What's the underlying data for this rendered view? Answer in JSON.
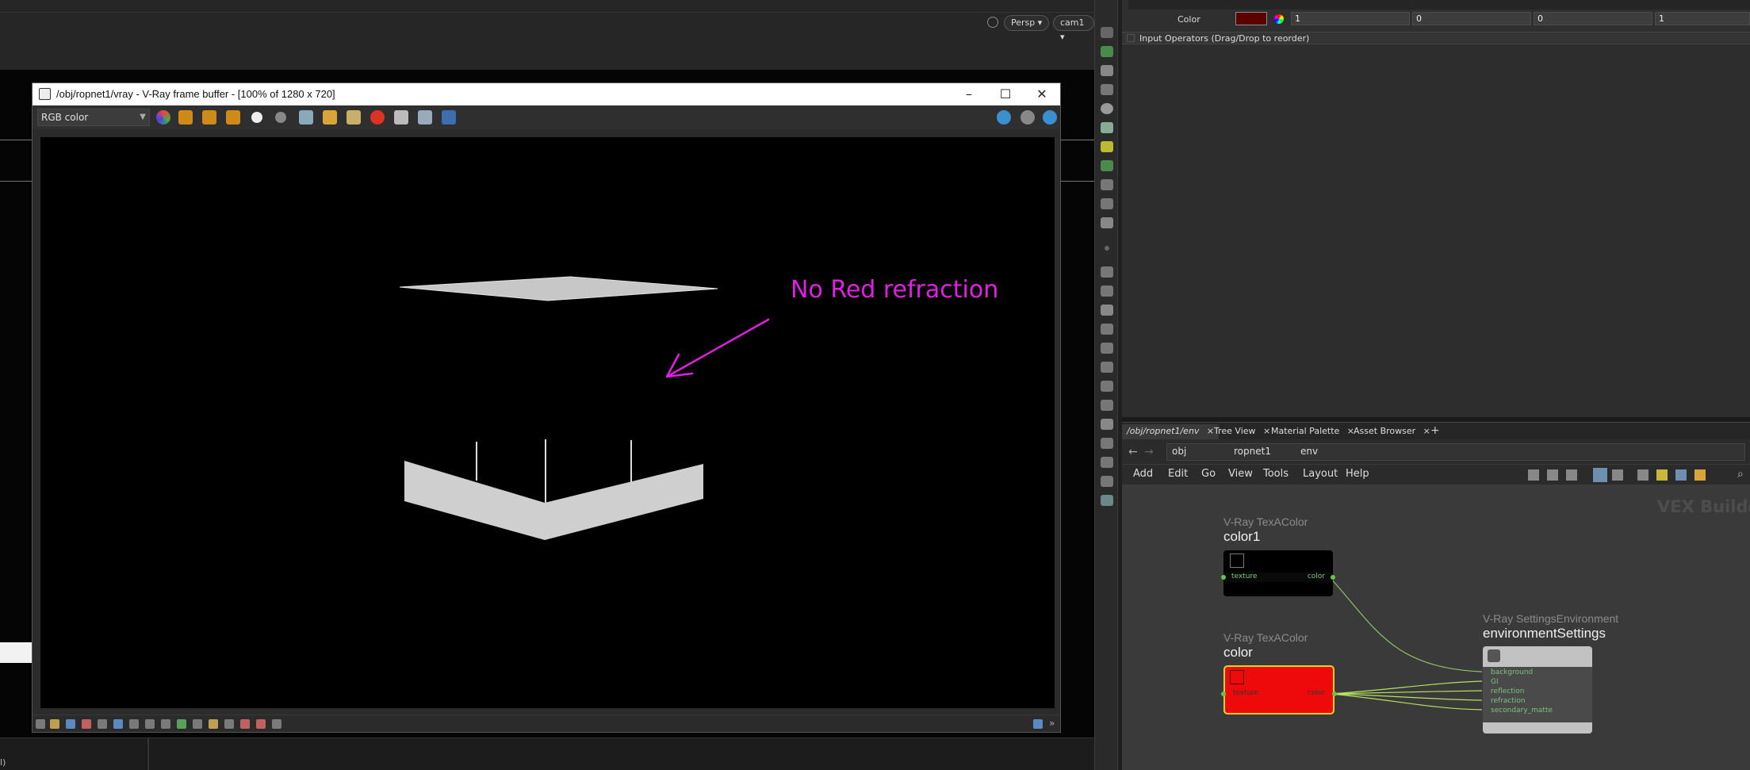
{
  "viewport": {
    "persp_label": "Persp",
    "cam_label": "cam1",
    "corner_text": "l)"
  },
  "vfb": {
    "title": "/obj/ropnet1/vray - V-Ray frame buffer - [100% of 1280 x 720]",
    "channel": "RGB color",
    "annotation": "No Red refraction",
    "annotation_color": "#e020e0"
  },
  "params": {
    "color_label": "Color",
    "color_swatch": "#5c0000",
    "values": [
      "1",
      "0",
      "0",
      "1"
    ],
    "input_operators": "Input Operators (Drag/Drop to reorder)"
  },
  "network": {
    "tabs": [
      "/obj/ropnet1/env",
      "Tree View",
      "Material Palette",
      "Asset Browser"
    ],
    "path": [
      "obj",
      "ropnet1",
      "env"
    ],
    "menu": [
      "Add",
      "Edit",
      "Go",
      "View",
      "Tools",
      "Layout",
      "Help"
    ],
    "watermark": "VEX Builder",
    "nodes": {
      "color1": {
        "type": "V-Ray TexAColor",
        "name": "color1",
        "port_in": "texture",
        "port_out": "color"
      },
      "color": {
        "type": "V-Ray TexAColor",
        "name": "color",
        "port_in": "texture",
        "port_out": "color"
      },
      "env": {
        "type": "V-Ray SettingsEnvironment",
        "name": "environmentSettings",
        "ports": [
          "background",
          "GI",
          "reflection",
          "refraction",
          "secondary_matte"
        ]
      }
    },
    "wire_color": "#9ccf6c",
    "selected_color": "#ff1010"
  }
}
